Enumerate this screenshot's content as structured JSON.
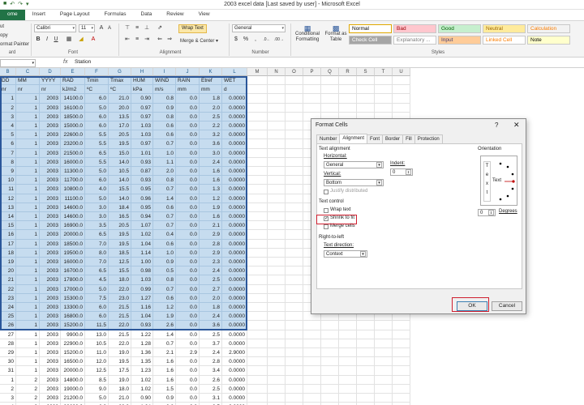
{
  "window": {
    "title": "2003 excel data [Last saved by user]  -  Microsoft Excel",
    "qat_icons": [
      "save-icon",
      "undo-icon",
      "redo-icon",
      "customize-icon"
    ]
  },
  "tabs": [
    {
      "label": "ome",
      "active": true
    },
    {
      "label": "Insert",
      "active": false
    },
    {
      "label": "Page Layout",
      "active": false
    },
    {
      "label": "Formulas",
      "active": false
    },
    {
      "label": "Data",
      "active": false
    },
    {
      "label": "Review",
      "active": false
    },
    {
      "label": "View",
      "active": false
    }
  ],
  "ribbon": {
    "clipboard": {
      "cut": "ut",
      "copy": "opy",
      "format_painter": "ormat Painter",
      "label": "ard"
    },
    "font": {
      "name": "Calibri",
      "size": "11",
      "label": "Font",
      "bold": "B",
      "italic": "I",
      "underline": "U"
    },
    "alignment": {
      "wrap_text": "Wrap Text",
      "merge": "Merge & Center",
      "label": "Alignment"
    },
    "number": {
      "format": "General",
      "label": "Number",
      "currency": "$",
      "percent": "%",
      "comma": ","
    },
    "styles": {
      "conditional": "Conditional Formatting",
      "format_table": "Format as Table",
      "label": "Styles",
      "cells": [
        {
          "label": "Normal",
          "bg": "#ffffff",
          "fg": "#000000"
        },
        {
          "label": "Bad",
          "bg": "#ffc7ce",
          "fg": "#9c0006"
        },
        {
          "label": "Good",
          "bg": "#c6efce",
          "fg": "#006100"
        },
        {
          "label": "Neutral",
          "bg": "#ffeb9c",
          "fg": "#9c6500"
        },
        {
          "label": "Calculation",
          "bg": "#f2f2f2",
          "fg": "#fa7d00"
        },
        {
          "label": "Check Cell",
          "bg": "#a5a5a5",
          "fg": "#ffffff"
        },
        {
          "label": "Explanatory ...",
          "bg": "#ffffff",
          "fg": "#7f7f7f"
        },
        {
          "label": "Input",
          "bg": "#ffcc99",
          "fg": "#3f3f76"
        },
        {
          "label": "Linked Cell",
          "bg": "#ffffff",
          "fg": "#fa7d00"
        },
        {
          "label": "Note",
          "bg": "#ffffcc",
          "fg": "#000000"
        }
      ]
    }
  },
  "formula_bar": {
    "fx": "fx",
    "value": "Station"
  },
  "columns": [
    "B",
    "C",
    "D",
    "E",
    "F",
    "G",
    "H",
    "I",
    "J",
    "K",
    "L",
    "M",
    "N",
    "O",
    "P",
    "Q",
    "R",
    "S",
    "T",
    "U"
  ],
  "header_rows": [
    [
      "DD",
      "MM",
      "YYYY",
      "RAD",
      "Tmin",
      "Tmax",
      "HUM",
      "WIND",
      "RAIN",
      "Etref",
      "WET"
    ],
    [
      "nr",
      "nr",
      "nr",
      "kJ/m2",
      "ºC",
      "ºC",
      "kPa",
      "m/s",
      "mm",
      "mm",
      "d"
    ]
  ],
  "data_rows": [
    [
      "1",
      "1",
      "2003",
      "14100.0",
      "6.0",
      "21.0",
      "0.90",
      "0.8",
      "0.0",
      "1.8",
      "0.0000"
    ],
    [
      "2",
      "1",
      "2003",
      "16100.0",
      "5.0",
      "20.0",
      "0.97",
      "0.9",
      "0.0",
      "2.0",
      "0.0000"
    ],
    [
      "3",
      "1",
      "2003",
      "18500.0",
      "6.0",
      "13.5",
      "0.97",
      "0.8",
      "0.0",
      "2.5",
      "0.0000"
    ],
    [
      "4",
      "1",
      "2003",
      "15000.0",
      "6.0",
      "17.0",
      "1.03",
      "0.6",
      "0.0",
      "2.2",
      "0.0000"
    ],
    [
      "5",
      "1",
      "2003",
      "22600.0",
      "5.5",
      "20.5",
      "1.03",
      "0.6",
      "0.0",
      "3.2",
      "0.0000"
    ],
    [
      "6",
      "1",
      "2003",
      "23200.0",
      "5.5",
      "19.5",
      "0.97",
      "0.7",
      "0.0",
      "3.6",
      "0.0000"
    ],
    [
      "7",
      "1",
      "2003",
      "21500.0",
      "6.5",
      "15.0",
      "1.01",
      "1.0",
      "0.0",
      "3.0",
      "0.0000"
    ],
    [
      "8",
      "1",
      "2003",
      "16000.0",
      "5.5",
      "14.0",
      "0.93",
      "1.1",
      "0.0",
      "2.4",
      "0.0000"
    ],
    [
      "9",
      "1",
      "2003",
      "11300.0",
      "5.0",
      "10.5",
      "0.87",
      "2.0",
      "0.0",
      "1.6",
      "0.0000"
    ],
    [
      "10",
      "1",
      "2003",
      "11700.0",
      "6.0",
      "14.0",
      "0.93",
      "0.8",
      "0.0",
      "1.6",
      "0.0000"
    ],
    [
      "11",
      "1",
      "2003",
      "10800.0",
      "4.0",
      "15.5",
      "0.95",
      "0.7",
      "0.0",
      "1.3",
      "0.0000"
    ],
    [
      "12",
      "1",
      "2003",
      "11100.0",
      "5.0",
      "14.0",
      "0.96",
      "1.4",
      "0.0",
      "1.2",
      "0.0000"
    ],
    [
      "13",
      "1",
      "2003",
      "14600.0",
      "3.0",
      "18.4",
      "0.95",
      "0.6",
      "0.0",
      "1.9",
      "0.0000"
    ],
    [
      "14",
      "1",
      "2003",
      "14600.0",
      "3.0",
      "16.5",
      "0.94",
      "0.7",
      "0.0",
      "1.6",
      "0.0000"
    ],
    [
      "15",
      "1",
      "2003",
      "16900.0",
      "3.5",
      "20.5",
      "1.07",
      "0.7",
      "0.0",
      "2.1",
      "0.0000"
    ],
    [
      "16",
      "1",
      "2003",
      "20000.0",
      "6.5",
      "19.5",
      "1.02",
      "0.4",
      "0.0",
      "2.9",
      "0.0000"
    ],
    [
      "17",
      "1",
      "2003",
      "18500.0",
      "7.0",
      "19.5",
      "1.04",
      "0.6",
      "0.0",
      "2.8",
      "0.0000"
    ],
    [
      "18",
      "1",
      "2003",
      "19500.0",
      "8.0",
      "18.5",
      "1.14",
      "1.0",
      "0.0",
      "2.9",
      "0.0000"
    ],
    [
      "19",
      "1",
      "2003",
      "16000.0",
      "7.0",
      "12.5",
      "1.00",
      "0.9",
      "0.0",
      "2.3",
      "0.0000"
    ],
    [
      "20",
      "1",
      "2003",
      "16700.0",
      "6.5",
      "15.5",
      "0.98",
      "0.5",
      "0.0",
      "2.4",
      "0.0000"
    ],
    [
      "21",
      "1",
      "2003",
      "17800.0",
      "4.5",
      "18.0",
      "1.03",
      "0.8",
      "0.0",
      "2.5",
      "0.0000"
    ],
    [
      "22",
      "1",
      "2003",
      "17000.0",
      "5.0",
      "22.0",
      "0.99",
      "0.7",
      "0.0",
      "2.7",
      "0.0000"
    ],
    [
      "23",
      "1",
      "2003",
      "15300.0",
      "7.5",
      "23.0",
      "1.27",
      "0.6",
      "0.0",
      "2.0",
      "0.0000"
    ],
    [
      "24",
      "1",
      "2003",
      "13300.0",
      "6.0",
      "21.5",
      "1.16",
      "1.2",
      "0.0",
      "1.8",
      "0.0000"
    ],
    [
      "25",
      "1",
      "2003",
      "16800.0",
      "6.0",
      "21.5",
      "1.04",
      "1.9",
      "0.0",
      "2.4",
      "0.0000"
    ],
    [
      "26",
      "1",
      "2003",
      "15200.0",
      "11.5",
      "22.0",
      "0.93",
      "2.6",
      "0.0",
      "3.6",
      "0.0000"
    ],
    [
      "27",
      "1",
      "2003",
      "9900.0",
      "13.0",
      "21.5",
      "1.22",
      "1.4",
      "0.0",
      "2.5",
      "0.0000"
    ],
    [
      "28",
      "1",
      "2003",
      "22900.0",
      "10.5",
      "22.0",
      "1.28",
      "0.7",
      "0.0",
      "3.7",
      "0.0000"
    ],
    [
      "29",
      "1",
      "2003",
      "15200.0",
      "11.0",
      "19.0",
      "1.36",
      "2.1",
      "2.9",
      "2.4",
      "2.9000"
    ],
    [
      "30",
      "1",
      "2003",
      "16500.0",
      "12.0",
      "19.5",
      "1.35",
      "1.6",
      "0.0",
      "2.8",
      "0.0000"
    ],
    [
      "31",
      "1",
      "2003",
      "20000.0",
      "12.5",
      "17.5",
      "1.23",
      "1.6",
      "0.0",
      "3.4",
      "0.0000"
    ],
    [
      "1",
      "2",
      "2003",
      "14800.0",
      "8.5",
      "19.0",
      "1.02",
      "1.6",
      "0.0",
      "2.6",
      "0.0000"
    ],
    [
      "2",
      "2",
      "2003",
      "19000.0",
      "9.0",
      "18.0",
      "1.02",
      "1.5",
      "0.0",
      "2.5",
      "0.0000"
    ],
    [
      "3",
      "2",
      "2003",
      "21200.0",
      "5.0",
      "21.0",
      "0.90",
      "0.9",
      "0.0",
      "3.1",
      "0.0000"
    ],
    [
      "4",
      "2",
      "2003",
      "23600.0",
      "6.0",
      "22.0",
      "1.04",
      "0.6",
      "0.0",
      "3.5",
      "0.0000"
    ],
    [
      "5",
      "2",
      "2003",
      "24000.0",
      "6.0",
      "23.0",
      "1.06",
      "0.7",
      "0.0",
      "3.6",
      "0.0000"
    ]
  ],
  "selected_data_rows": 26,
  "dialog": {
    "title": "Format Cells",
    "help": "?",
    "close": "✕",
    "tabs": [
      {
        "label": "Number",
        "active": false
      },
      {
        "label": "Alignment",
        "active": true
      },
      {
        "label": "Font",
        "active": false
      },
      {
        "label": "Border",
        "active": false
      },
      {
        "label": "Fill",
        "active": false
      },
      {
        "label": "Protection",
        "active": false
      }
    ],
    "text_alignment": "Text alignment",
    "horizontal_label": "Horizontal:",
    "horizontal_value": "General",
    "indent_label": "Indent:",
    "indent_value": "0",
    "vertical_label": "Vertical:",
    "vertical_value": "Bottom",
    "justify_distributed": "Justify distributed",
    "text_control": "Text control",
    "wrap_text": "Wrap text",
    "shrink_to_fit": "Shrink to fit",
    "merge_cells": "Merge cells",
    "rtl": "Right-to-left",
    "text_direction_label": "Text direction:",
    "text_direction_value": "Context",
    "orientation": "Orientation",
    "orient_text_vertical": [
      "T",
      "e",
      "x",
      "t"
    ],
    "orient_text_horizontal": "Text",
    "degrees_value": "0",
    "degrees_label": "Degrees",
    "ok": "OK",
    "cancel": "Cancel",
    "shrink_checked": true,
    "highlight_color": "#cf1f2f"
  }
}
